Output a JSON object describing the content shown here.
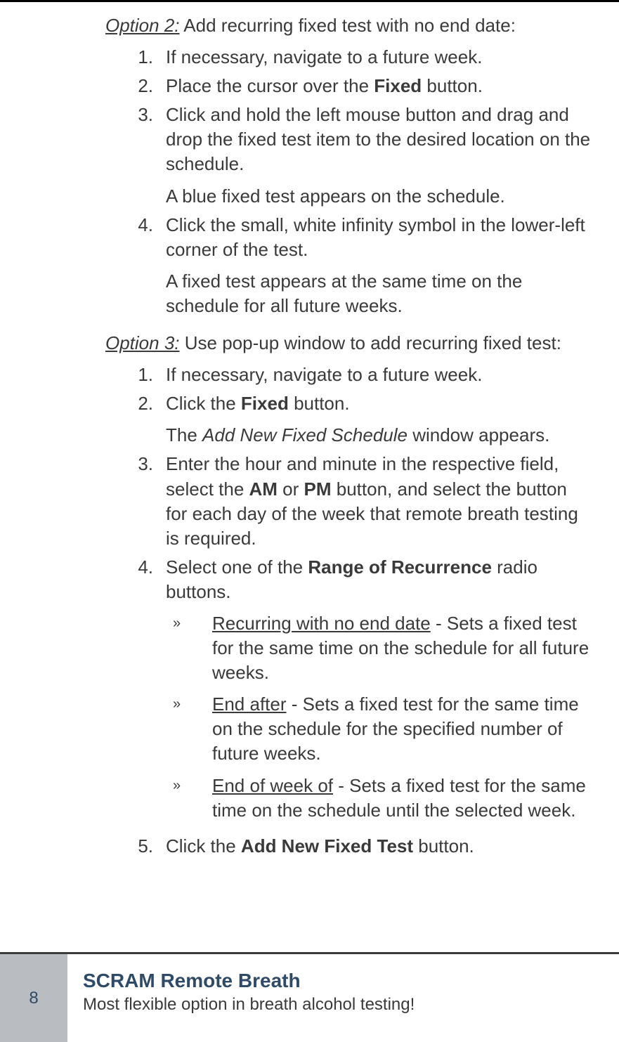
{
  "option2": {
    "label": "Option 2:",
    "lead": " Add recurring fixed test with no end date:",
    "steps": [
      {
        "num": "1.",
        "text": "If necessary, navigate to a future week."
      },
      {
        "num": "2.",
        "pre": "Place the cursor over the ",
        "bold": "Fixed",
        "post": " button."
      },
      {
        "num": "3.",
        "text": "Click and hold the left mouse button and drag and drop the fixed test item to the desired location on the schedule.",
        "result": "A blue fixed test appears on the schedule."
      },
      {
        "num": "4.",
        "text": "Click the small, white infinity symbol in the lower-left corner of the test.",
        "result": "A fixed test appears at the same time on the schedule for all future weeks."
      }
    ]
  },
  "option3": {
    "label": "Option 3:",
    "lead": " Use pop-up window to add recurring fixed test:",
    "steps": {
      "s1": {
        "num": "1.",
        "text": "If necessary, navigate to a future week."
      },
      "s2": {
        "num": "2.",
        "pre": "Click the ",
        "bold": "Fixed",
        "post": " button.",
        "result_pre": "The ",
        "result_ital": "Add New Fixed Schedule",
        "result_post": " window ap­pears."
      },
      "s3": {
        "num": "3.",
        "pre": "Enter the hour and minute in the respec­tive field, select the ",
        "b1": "AM",
        "mid": " or ",
        "b2": "PM",
        "post": " button, and select the button for each day of the week that remote breath testing is required."
      },
      "s4": {
        "num": "4.",
        "pre": "Select one of the ",
        "bold": "Range of Recurrence",
        "post": " radio buttons.",
        "subs": [
          {
            "chev": "»",
            "u": "Recurring with no end date",
            "rest": " - Sets a fixed test for the same time on the schedule for all future weeks."
          },
          {
            "chev": "»",
            "u": "End after",
            "rest": " - Sets a fixed test for the same time on the schedule for the specified number of future weeks."
          },
          {
            "chev": "»",
            "u": "End of week of",
            "rest": " - Sets a fixed test for the same time on the schedule until the selected week."
          }
        ]
      },
      "s5": {
        "num": "5.",
        "pre": "Click the ",
        "bold": "Add New Fixed Test",
        "post": " button."
      }
    }
  },
  "footer": {
    "page": "8",
    "title": "SCRAM Remote Breath",
    "sub": "Most flexible option in breath alcohol testing!"
  }
}
